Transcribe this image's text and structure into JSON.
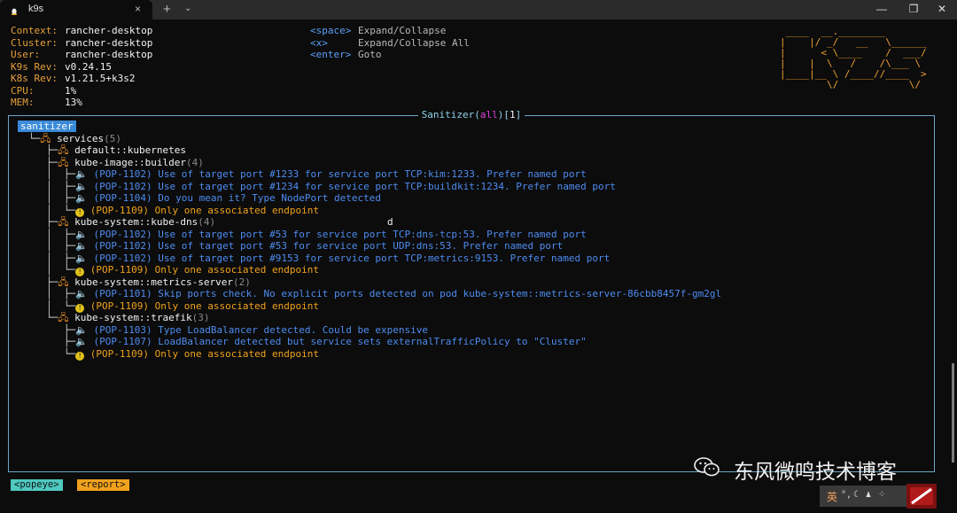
{
  "window": {
    "tab_title": "k9s",
    "close_tab_glyph": "×",
    "new_tab_glyph": "+",
    "tab_dropdown_glyph": "⌄",
    "minimize_glyph": "—",
    "maximize_glyph": "❐",
    "close_glyph": "✕"
  },
  "header": {
    "info": [
      {
        "key": "Context:",
        "value": "rancher-desktop"
      },
      {
        "key": "Cluster:",
        "value": "rancher-desktop"
      },
      {
        "key": "User:",
        "value": "rancher-desktop"
      },
      {
        "key": "K9s Rev:",
        "value": "v0.24.15"
      },
      {
        "key": "K8s Rev:",
        "value": "v1.21.5+k3s2"
      },
      {
        "key": "CPU:",
        "value": "1%"
      },
      {
        "key": "MEM:",
        "value": "13%"
      }
    ],
    "keys": [
      {
        "key": "<space>",
        "action": "Expand/Collapse"
      },
      {
        "key": "<x>",
        "action": "Expand/Collapse All"
      },
      {
        "key": "<enter>",
        "action": "Goto"
      }
    ],
    "logo": " ____  __.________\n|    |/ _/   __   \\______\n|      < \\____    /  ___/\n|    |  \\   /    /\\___ \\\n|____|__ \\ /____//____  >\n        \\/            \\/"
  },
  "panel": {
    "title_prefix": "Sanitizer(",
    "title_filter": "all",
    "title_suffix": ")[",
    "title_count": "1",
    "title_end": "]"
  },
  "tree": {
    "root": "sanitizer",
    "services_label": "services",
    "services_count": "(5)",
    "groups": [
      {
        "name": "default::kubernetes",
        "count": "",
        "issues": []
      },
      {
        "name": "kube-image::builder",
        "count": "(4)",
        "issues": [
          {
            "level": "warn",
            "text": "(POP-1102) Use of target port #1233 for service port TCP:kim:1233. Prefer named port"
          },
          {
            "level": "warn",
            "text": "(POP-1102) Use of target port #1234 for service port TCP:buildkit:1234. Prefer named port"
          },
          {
            "level": "warn",
            "text": "(POP-1104) Do you mean it? Type NodePort detected"
          },
          {
            "level": "err",
            "text": "(POP-1109) Only one associated endpoint"
          }
        ]
      },
      {
        "name": "kube-system::kube-dns",
        "count": "(4)",
        "issues": [
          {
            "level": "warn",
            "text": "(POP-1102) Use of target port #53 for service port TCP:dns-tcp:53. Prefer named port"
          },
          {
            "level": "warn",
            "text": "(POP-1102) Use of target port #53 for service port UDP:dns:53. Prefer named port"
          },
          {
            "level": "warn",
            "text": "(POP-1102) Use of target port #9153 for service port TCP:metrics:9153. Prefer named port"
          },
          {
            "level": "err",
            "text": "(POP-1109) Only one associated endpoint"
          }
        ]
      },
      {
        "name": "kube-system::metrics-server",
        "count": "(2)",
        "issues": [
          {
            "level": "warn",
            "text": "(POP-1101) Skip ports check. No explicit ports detected on pod kube-system::metrics-server-86cbb8457f-gm2gl"
          },
          {
            "level": "err",
            "text": "(POP-1109) Only one associated endpoint"
          }
        ]
      },
      {
        "name": "kube-system::traefik",
        "count": "(3)",
        "issues": [
          {
            "level": "warn",
            "text": "(POP-1103) Type LoadBalancer detected. Could be expensive"
          },
          {
            "level": "warn",
            "text": "(POP-1107) LoadBalancer detected but service sets externalTrafficPolicy to \"Cluster\""
          },
          {
            "level": "err",
            "text": "(POP-1109) Only one associated endpoint"
          }
        ]
      }
    ],
    "stray_char": "d"
  },
  "crumbs": [
    "<popeye>",
    "<report>"
  ],
  "watermark": "东风微鸣技术博客",
  "tray": {
    "ime": "英"
  },
  "colors": {
    "warn": "#4d8cf0",
    "error": "#f0a21c",
    "accent": "#6aa6c8",
    "selection": "#3a8ad8"
  }
}
